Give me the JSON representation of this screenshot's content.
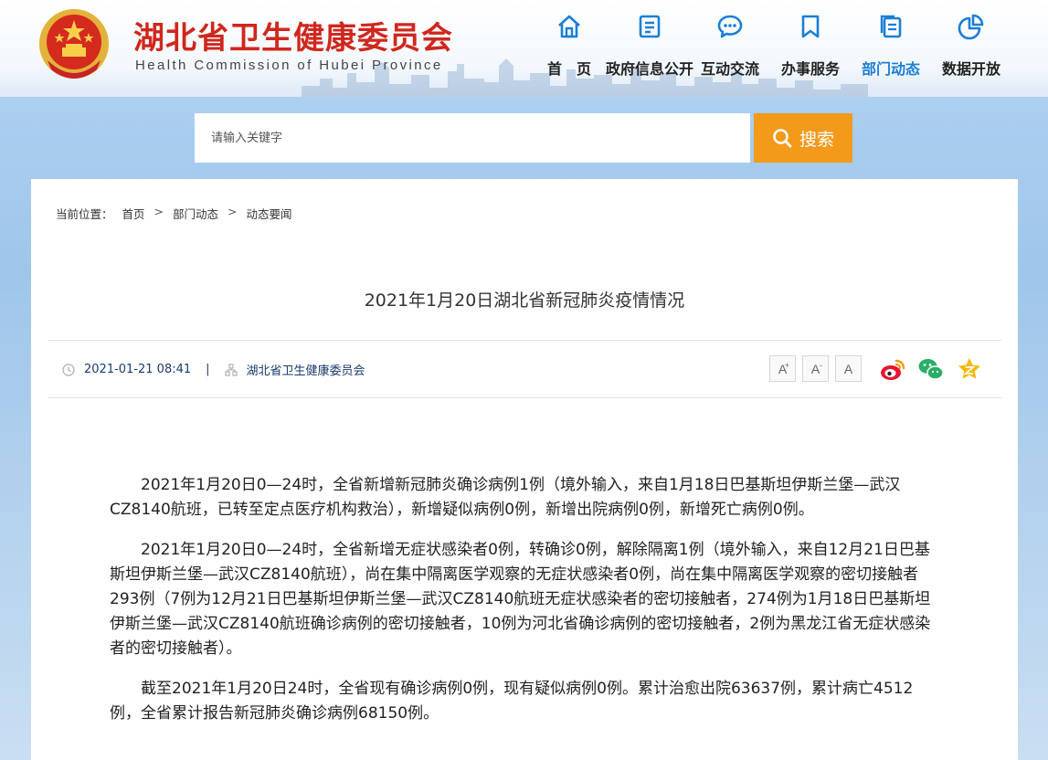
{
  "header": {
    "site_name_cn": "湖北省卫生健康委员会",
    "site_name_en": "Health Commission of Hubei Province",
    "nav": [
      {
        "label": "首　页",
        "icon": "home-icon"
      },
      {
        "label": "政府信息公开",
        "icon": "document-icon"
      },
      {
        "label": "互动交流",
        "icon": "chat-bubble-icon"
      },
      {
        "label": "办事服务",
        "icon": "bookmark-icon"
      },
      {
        "label": "部门动态",
        "icon": "pages-icon",
        "active": true
      },
      {
        "label": "数据开放",
        "icon": "pie-chart-icon"
      }
    ]
  },
  "search": {
    "placeholder": "请输入关键字",
    "button_label": "搜索"
  },
  "breadcrumb": {
    "prefix": "当前位置：",
    "items": [
      "首页",
      "部门动态",
      "动态要闻"
    ],
    "separator": ">"
  },
  "article": {
    "title": "2021年1月20日湖北省新冠肺炎疫情情况",
    "datetime": "2021-01-21 08:41",
    "divider": "|",
    "source": "湖北省卫生健康委员会",
    "font_sizes": [
      "A",
      "A",
      "A"
    ],
    "paragraphs": [
      "2021年1月20日0—24时，全省新增新冠肺炎确诊病例1例（境外输入，来自1月18日巴基斯坦伊斯兰堡—武汉CZ8140航班，已转至定点医疗机构救治），新增疑似病例0例，新增出院病例0例，新增死亡病例0例。",
      "2021年1月20日0—24时，全省新增无症状感染者0例，转确诊0例，解除隔离1例（境外输入，来自12月21日巴基斯坦伊斯兰堡—武汉CZ8140航班），尚在集中隔离医学观察的无症状感染者0例，尚在集中隔离医学观察的密切接触者293例（7例为12月21日巴基斯坦伊斯兰堡—武汉CZ8140航班无症状感染者的密切接触者，274例为1月18日巴基斯坦伊斯兰堡—武汉CZ8140航班确诊病例的密切接触者，10例为河北省确诊病例的密切接触者，2例为黑龙江省无症状感染者的密切接触者）。",
      "截至2021年1月20日24时，全省现有确诊病例0例，现有疑似病例0例。累计治愈出院63637例，累计病亡4512例，全省累计报告新冠肺炎确诊病例68150例。"
    ]
  },
  "colors": {
    "brand_red": "#d0271d",
    "nav_blue": "#1b7ed6",
    "search_orange": "#f39a1b",
    "weibo": "#e6162d",
    "wechat": "#2aae67",
    "favorite": "#f5b800"
  }
}
